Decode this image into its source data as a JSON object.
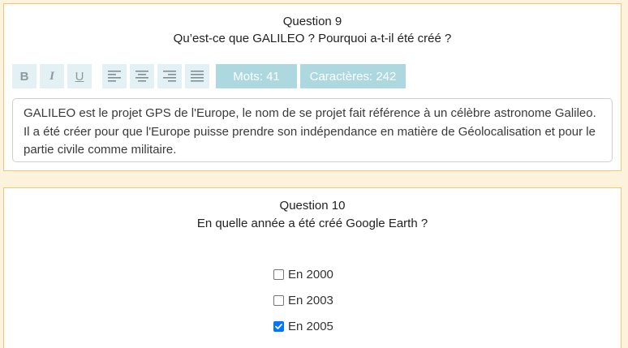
{
  "question9": {
    "title": "Question 9",
    "text": "Qu’est-ce que GALILEO ? Pourquoi a-t-il été créé ?",
    "toolbar": {
      "bold_icon": "bold-icon",
      "italic_icon": "italic-icon",
      "underline_icon": "underline-icon",
      "align_left_icon": "align-left-icon",
      "align_center_icon": "align-center-icon",
      "align_right_icon": "align-right-icon",
      "align_justify_icon": "align-justify-icon",
      "word_count": "Mots: 41",
      "char_count": "Caractères: 242"
    },
    "answer": "GALILEO est le projet GPS de l'Europe, le nom de se projet fait référence à un célèbre astronome Galileo. Il a été créer pour que l'Europe puisse prendre son indépendance en matière de Géolocalisation et pour le partie civile comme militaire."
  },
  "question10": {
    "title": "Question 10",
    "text": "En quelle année a été créé Google Earth ?",
    "options": [
      {
        "label": "En 2000",
        "checked": false
      },
      {
        "label": "En 2003",
        "checked": false
      },
      {
        "label": "En 2005",
        "checked": true
      }
    ]
  },
  "colors": {
    "background": "#fdf3dc",
    "card_border": "#f3c77a",
    "toolbar_button": "#e3f1f4",
    "counter_badge": "#add8e0",
    "checkbox_checked": "#0075ff"
  }
}
